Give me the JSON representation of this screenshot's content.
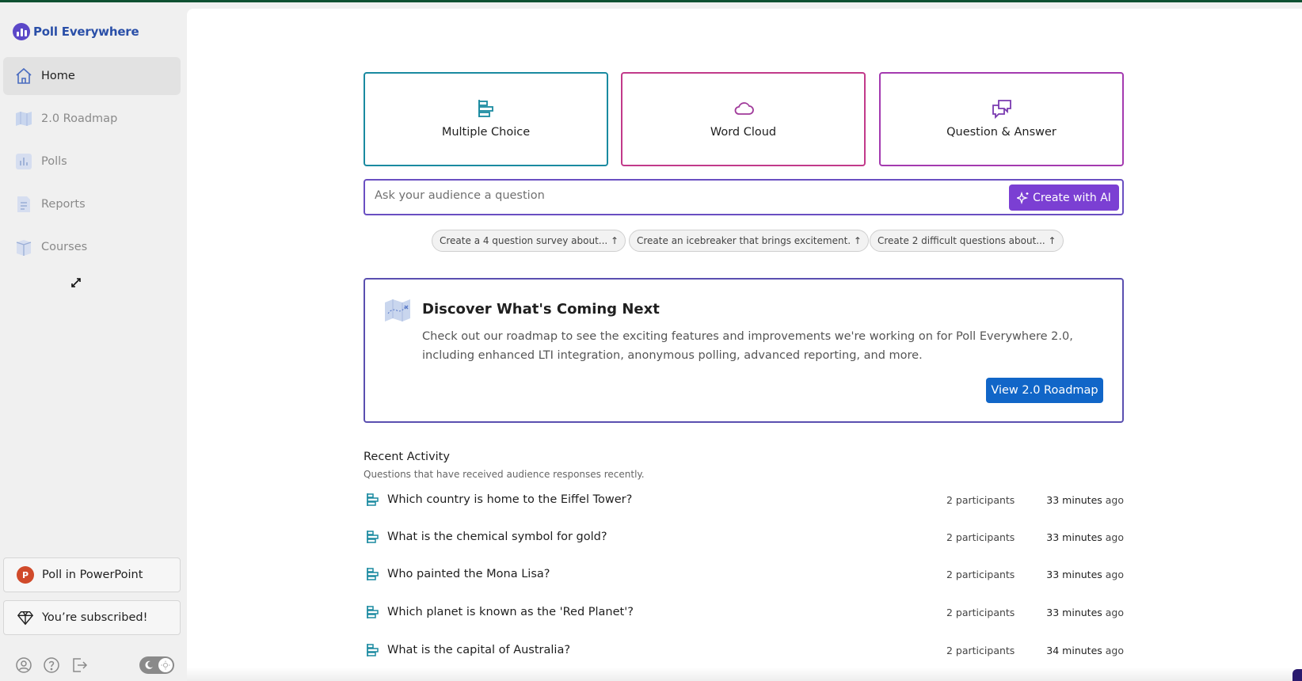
{
  "app": {
    "name": "Poll Everywhere",
    "colors": {
      "accent_purple": "#7b3fd3",
      "primary_blue": "#1166c8",
      "teal": "#1a8aa0",
      "magenta": "#c23a8a",
      "purple_border": "#6a4fc2"
    }
  },
  "sidebar": {
    "logo_text": "Poll Everywhere",
    "items": [
      {
        "label": "Home",
        "icon": "home-icon",
        "active": true
      },
      {
        "label": "2.0 Roadmap",
        "icon": "map-icon",
        "active": false
      },
      {
        "label": "Polls",
        "icon": "bar-chart-icon",
        "active": false
      },
      {
        "label": "Reports",
        "icon": "report-icon",
        "active": false
      },
      {
        "label": "Courses",
        "icon": "courses-icon",
        "active": false
      }
    ],
    "powerpoint_label": "Poll in PowerPoint",
    "powerpoint_icon_text": "P",
    "subscribed_label": "You’re subscribed!",
    "footer_icons": [
      "account-icon",
      "help-icon",
      "logout-icon"
    ]
  },
  "question_types": [
    {
      "label": "Multiple Choice",
      "icon": "multiple-choice-icon",
      "border": "#1a8aa0",
      "icon_color": "#1a8aa0"
    },
    {
      "label": "Word Cloud",
      "icon": "cloud-icon",
      "border": "#c23a8a",
      "icon_color": "#a03a9a"
    },
    {
      "label": "Question & Answer",
      "icon": "chat-icon",
      "border": "#a43ab0",
      "icon_color": "#7a3ab0"
    }
  ],
  "ask": {
    "placeholder": "Ask your audience a question",
    "ai_button": "Create with AI"
  },
  "suggestions": [
    "Create a 4 question survey about... ↑",
    "Create an icebreaker that brings excitement. ↑",
    "Create 2 difficult questions about... ↑"
  ],
  "discover": {
    "title": "Discover What's Coming Next",
    "body": "Check out our roadmap to see the exciting features and improvements we're working on for Poll Everywhere 2.0, including enhanced LTI integration, anonymous polling, advanced reporting, and more.",
    "button": "View 2.0 Roadmap"
  },
  "recent": {
    "title": "Recent Activity",
    "subtitle": "Questions that have received audience responses recently.",
    "rows": [
      {
        "question": "Which country is home to the Eiffel Tower?",
        "participants": "2 participants",
        "time_value": "33 minutes",
        "time_suffix": " ago"
      },
      {
        "question": "What is the chemical symbol for gold?",
        "participants": "2 participants",
        "time_value": "33 minutes",
        "time_suffix": " ago"
      },
      {
        "question": "Who painted the Mona Lisa?",
        "participants": "2 participants",
        "time_value": "33 minutes",
        "time_suffix": " ago"
      },
      {
        "question": "Which planet is known as the 'Red Planet'?",
        "participants": "2 participants",
        "time_value": "33 minutes",
        "time_suffix": " ago"
      },
      {
        "question": "What is the capital of Australia?",
        "participants": "2 participants",
        "time_value": "34 minutes",
        "time_suffix": " ago"
      }
    ]
  }
}
